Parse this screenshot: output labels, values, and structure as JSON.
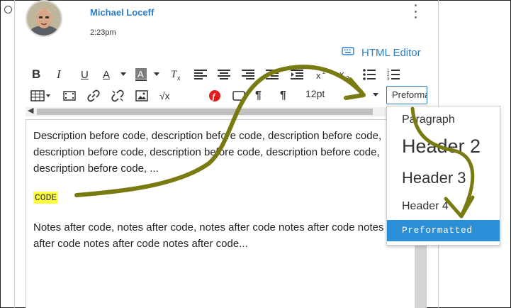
{
  "post": {
    "author": "Michael Loceff",
    "time": "2:23pm"
  },
  "editor": {
    "html_editor_label": "HTML Editor",
    "font_size": "12pt",
    "format_value": "Preformatted",
    "content": {
      "before": "Description before code, description before code, description before code, description before code, description before code, description before code, description before code, ...",
      "code": "CODE",
      "after": "Notes after code, notes after code, notes after code notes after code notes after code notes after code notes after code..."
    }
  },
  "format_dropdown": {
    "items": [
      {
        "label": "Paragraph",
        "selected": false
      },
      {
        "label": "Header 2",
        "selected": false
      },
      {
        "label": "Header 3",
        "selected": false
      },
      {
        "label": "Header 4",
        "selected": false
      },
      {
        "label": "Preformatted",
        "selected": true
      }
    ]
  },
  "colors": {
    "link": "#2d7ec4",
    "selection": "#2a8fd6",
    "highlight": "#ffff3d",
    "annotation_arrow": "#7a7a12"
  },
  "icons": {
    "toolbar_row1": [
      "bold-icon",
      "italic-icon",
      "underline-icon",
      "text-color-icon",
      "background-color-icon",
      "clear-formatting-icon",
      "align-left-icon",
      "align-center-icon",
      "align-right-icon",
      "outdent-icon",
      "indent-icon",
      "superscript-icon",
      "subscript-icon",
      "bullet-list-icon",
      "numbered-list-icon"
    ],
    "toolbar_row2": [
      "table-icon",
      "media-icon",
      "link-icon",
      "unlink-icon",
      "image-icon",
      "math-equation-icon",
      "flash-icon",
      "embed-icon",
      "ltr-icon",
      "rtl-icon"
    ]
  }
}
